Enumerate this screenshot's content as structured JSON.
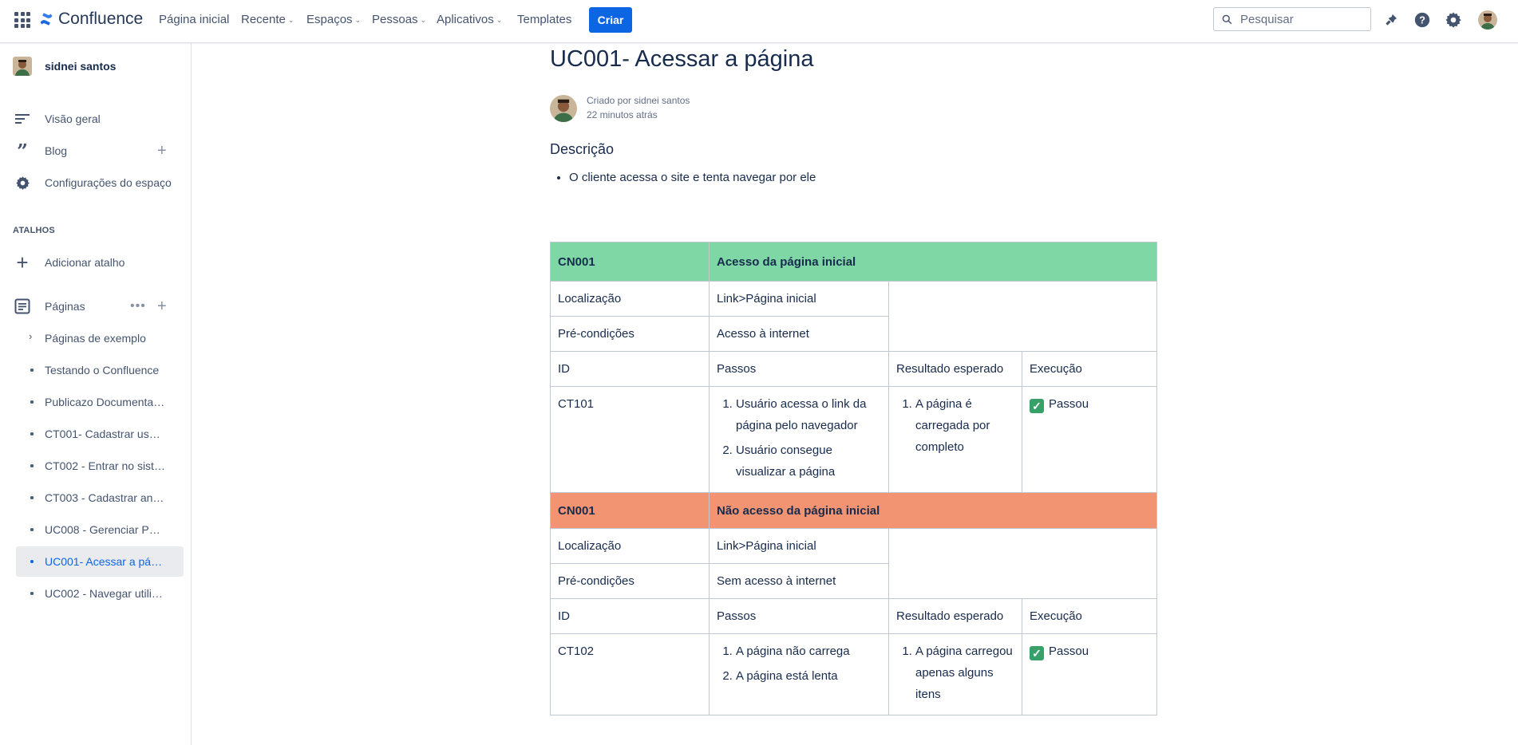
{
  "topnav": {
    "product_name": "Confluence",
    "links": [
      "Página inicial",
      "Recente",
      "Espaços",
      "Pessoas",
      "Aplicativos",
      "Templates"
    ],
    "create_label": "Criar",
    "search_placeholder": "Pesquisar",
    "icons": [
      "app-switcher-icon",
      "notifications-icon",
      "help-icon",
      "settings-icon"
    ],
    "accent_color": "#0c66e4"
  },
  "sidebar": {
    "user_name": "sidnei santos",
    "items": [
      {
        "label": "Visão geral",
        "icon": "overview-icon"
      },
      {
        "label": "Blog",
        "icon": "quote-icon"
      },
      {
        "label": "Configurações do espaço",
        "icon": "gear-icon"
      }
    ],
    "shortcuts_title": "ATALHOS",
    "add_shortcut_label": "Adicionar atalho",
    "pages_label": "Páginas",
    "tree": [
      {
        "label": "Páginas de exemplo",
        "type": "folder"
      },
      {
        "label": "Testando o Confluence"
      },
      {
        "label": "Publicazo Documentaç..."
      },
      {
        "label": "CT001- Cadastrar usuá..."
      },
      {
        "label": "CT002 - Entrar no siste..."
      },
      {
        "label": "CT003 - Cadastrar anú..."
      },
      {
        "label": "UC008 - Gerenciar Perfil"
      },
      {
        "label": "UC001- Acessar a pági...",
        "active": true
      },
      {
        "label": "UC002 - Navegar utiliz..."
      }
    ]
  },
  "page": {
    "title": "UC001- Acessar a página",
    "created_by": "Criado por sidnei santos",
    "created_time": "22 minutos atrás",
    "description_heading": "Descrição",
    "description_items": [
      "O cliente acessa o site e tenta navegar por ele"
    ]
  },
  "table": {
    "header_colors": {
      "success": "#7fd7a5",
      "failure": "#f29472"
    },
    "blocks": [
      {
        "code": "CN001",
        "title": "Acesso da página inicial",
        "location_label": "Localização",
        "location_value": "Link>Página inicial",
        "precond_label": "Pré-condições",
        "precond_value": "Acesso à internet",
        "col_id": "ID",
        "col_steps": "Passos",
        "col_expected": "Resultado esperado",
        "col_exec": "Execução",
        "case_id": "CT101",
        "steps": [
          "Usuário acessa o link da página pelo navegador",
          "Usuário consegue visualizar a página"
        ],
        "expected": [
          "A página é carregada por completo"
        ],
        "execution": "Passou"
      },
      {
        "code": "CN001",
        "title": "Não acesso da página inicial",
        "location_label": "Localização",
        "location_value": "Link>Página inicial",
        "precond_label": "Pré-condições",
        "precond_value": "Sem acesso à internet",
        "col_id": "ID",
        "col_steps": "Passos",
        "col_expected": "Resultado esperado",
        "col_exec": "Execução",
        "case_id": "CT102",
        "steps": [
          "A página não carrega",
          "A página está lenta"
        ],
        "expected": [
          "A página carregou apenas alguns itens"
        ],
        "execution": "Passou"
      }
    ]
  }
}
